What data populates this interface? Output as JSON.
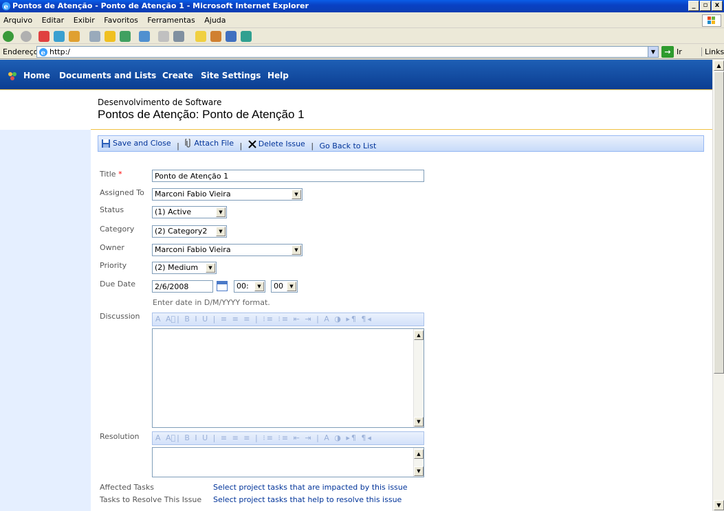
{
  "window": {
    "title": "Pontos de Atenção - Ponto de Atenção 1 - Microsoft Internet Explorer",
    "controls": [
      "_",
      "▫",
      "x"
    ]
  },
  "menu": [
    "Arquivo",
    "Editar",
    "Exibir",
    "Favoritos",
    "Ferramentas",
    "Ajuda"
  ],
  "address": {
    "label": "Endereço",
    "value": "http:/",
    "go_label": "Ir",
    "links_label": "Links"
  },
  "sp_nav": [
    "Home",
    "Documents and Lists",
    "Create",
    "Site Settings",
    "Help"
  ],
  "header": {
    "site_title": "Desenvolvimento de Software",
    "page_title": "Pontos de Atenção: Ponto de Atenção 1"
  },
  "actions": {
    "save": "Save and Close",
    "attach": "Attach File",
    "delete": "Delete Issue",
    "back": "Go Back to List",
    "sep": "|"
  },
  "form": {
    "title_label": "Title",
    "required_mark": "*",
    "title_value": "Ponto de Atenção 1",
    "assigned_label": "Assigned To",
    "assigned_value": "Marconi Fabio Vieira",
    "status_label": "Status",
    "status_value": "(1) Active",
    "category_label": "Category",
    "category_value": "(2) Category2",
    "owner_label": "Owner",
    "owner_value": "Marconi Fabio Vieira",
    "priority_label": "Priority",
    "priority_value": "(2) Medium",
    "due_label": "Due Date",
    "due_value": "2/6/2008",
    "due_hour": "00:",
    "due_min": "00",
    "due_hint": "Enter date in D/M/YYYY format.",
    "discussion_label": "Discussion",
    "resolution_label": "Resolution",
    "rte_tools": "A A⃒| B I U | ≡ ≡ ≡ | ⁝≡ ⁝≡ ⇤ ⇥ | A ◑ ▸¶ ¶◂",
    "affected_label": "Affected Tasks",
    "affected_link": "Select project tasks that are impacted by this issue",
    "resolve_label": "Tasks to Resolve This Issue",
    "resolve_link": "Select project tasks that help to resolve this issue"
  },
  "colors": {
    "nav_bg": "#0b3d91",
    "link": "#003399",
    "required": "#ff0000",
    "accent_gold": "#f0c040"
  }
}
